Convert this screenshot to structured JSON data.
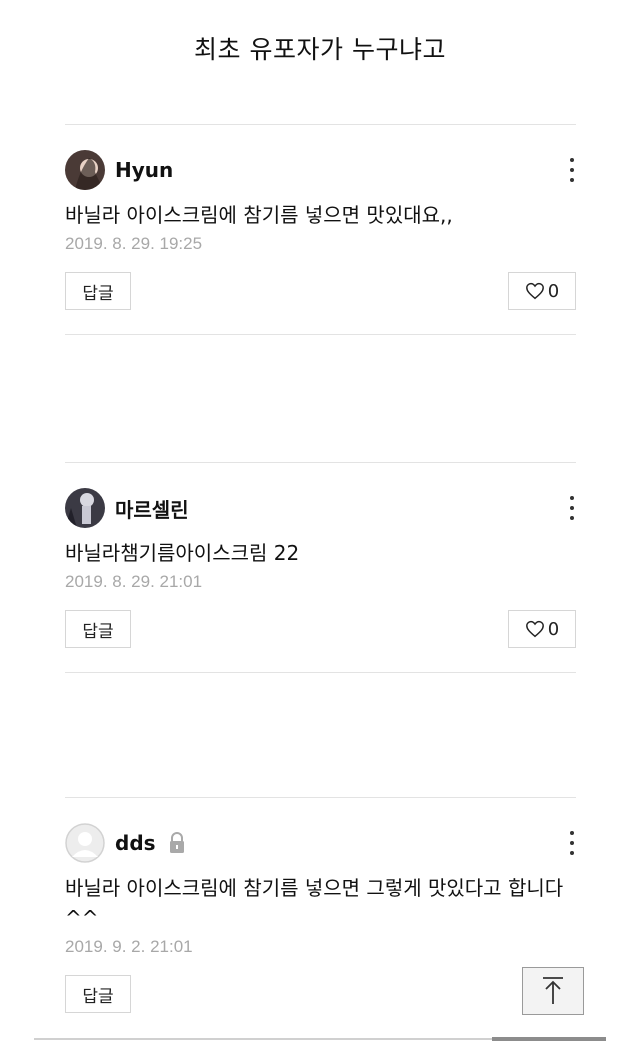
{
  "page": {
    "title": "최초 유포자가 누구냐고"
  },
  "comments": [
    {
      "author": "Hyun",
      "text": "바닐라 아이스크림에 참기름 넣으면 맛있대요,,",
      "date": "2019. 8. 29. 19:25",
      "reply_label": "답글",
      "like_count": "0",
      "locked": false
    },
    {
      "author": "마르셀린",
      "text": "바닐라챔기름아이스크림 22",
      "date": "2019. 8. 29. 21:01",
      "reply_label": "답글",
      "like_count": "0",
      "locked": false
    },
    {
      "author": "dds",
      "text": "바닐라 아이스크림에 참기름 넣으면 그렇게 맛있다고 합니다^^",
      "date": "2019. 9. 2. 21:01",
      "reply_label": "답글",
      "like_count": "",
      "locked": true
    }
  ],
  "icons": {
    "kebab": "more-vertical-icon",
    "like": "heart-outline-icon",
    "lock": "lock-icon",
    "scroll_top": "arrow-up-icon"
  },
  "colors": {
    "text": "#111111",
    "date": "#a8a8a8",
    "border": "#d6d6d6",
    "divider": "#e3e3e3"
  }
}
